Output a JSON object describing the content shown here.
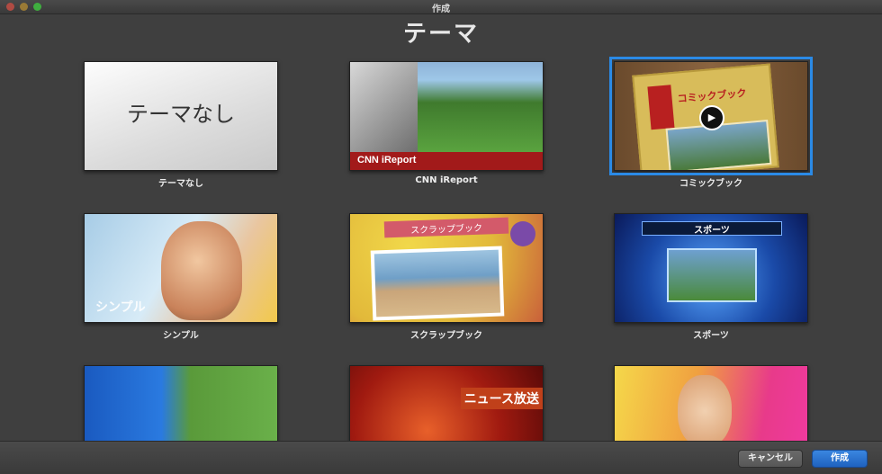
{
  "window": {
    "title": "作成"
  },
  "header": {
    "title": "テーマ"
  },
  "themes": [
    {
      "label": "テーマなし",
      "thumb_text": "テーマなし"
    },
    {
      "label": "CNN iReport",
      "thumb_text": "CNN iReport"
    },
    {
      "label": "コミックブック",
      "thumb_text": "コミックブック",
      "selected": true
    },
    {
      "label": "シンプル",
      "thumb_text": "シンプル"
    },
    {
      "label": "スクラップブック",
      "thumb_text": "スクラップブック"
    },
    {
      "label": "スポーツ",
      "thumb_text": "スポーツ"
    },
    {
      "label": "",
      "thumb_text": ""
    },
    {
      "label": "",
      "thumb_text": "ニュース放送"
    },
    {
      "label": "",
      "thumb_text": ""
    }
  ],
  "footer": {
    "cancel_label": "キャンセル",
    "create_label": "作成"
  },
  "colors": {
    "accent": "#2a8ae6",
    "background": "#3f3f3f"
  }
}
